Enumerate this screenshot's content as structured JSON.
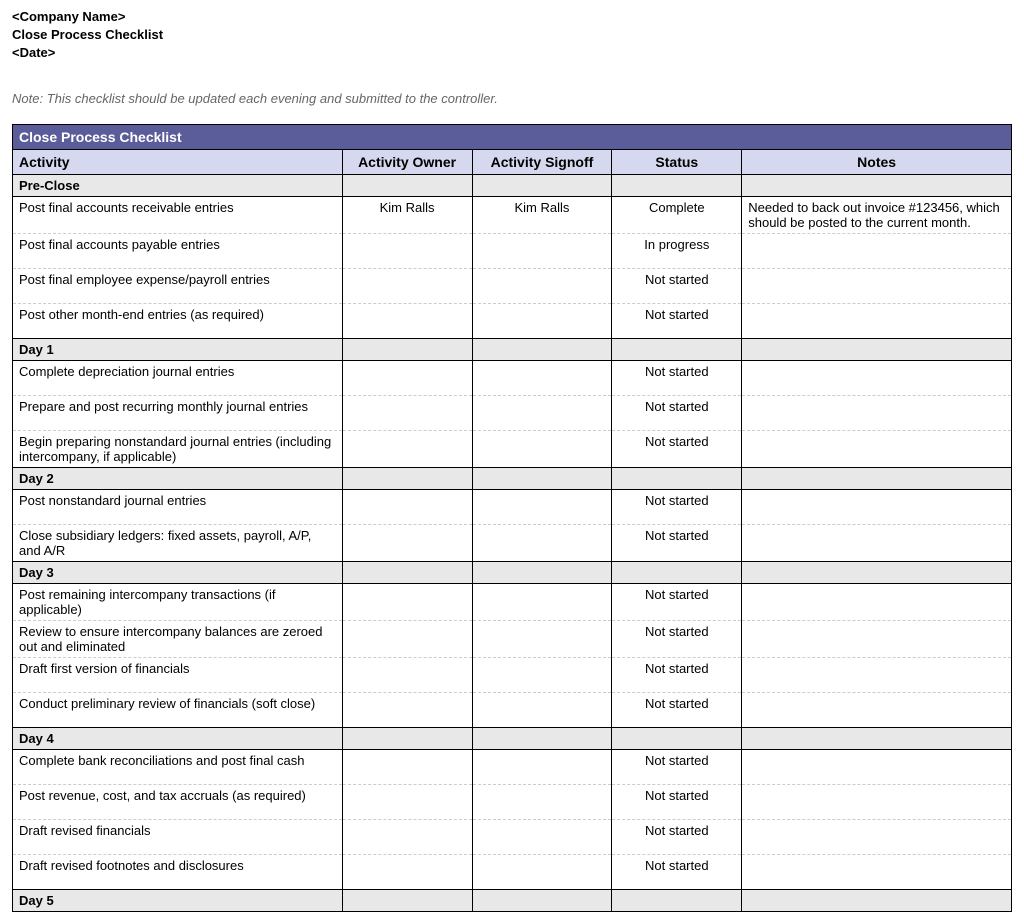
{
  "header": {
    "company": "<Company Name>",
    "title": "Close Process Checklist",
    "date": "<Date>"
  },
  "note": "Note: This checklist should be updated each evening and submitted to the controller.",
  "table_title": "Close Process Checklist",
  "columns": {
    "activity": "Activity",
    "owner": "Activity Owner",
    "signoff": "Activity Signoff",
    "status": "Status",
    "notes": "Notes"
  },
  "sections": [
    {
      "name": "Pre-Close",
      "rows": [
        {
          "activity": "Post final accounts receivable entries",
          "owner": "Kim Ralls",
          "signoff": "Kim Ralls",
          "status": "Complete",
          "notes": "Needed to back out invoice #123456, which should be posted to the current month."
        },
        {
          "activity": "Post final accounts payable entries",
          "owner": "",
          "signoff": "",
          "status": "In progress",
          "notes": ""
        },
        {
          "activity": "Post final employee expense/payroll entries",
          "owner": "",
          "signoff": "",
          "status": "Not started",
          "notes": ""
        },
        {
          "activity": "Post other month-end entries (as required)",
          "owner": "",
          "signoff": "",
          "status": "Not started",
          "notes": ""
        }
      ]
    },
    {
      "name": "Day 1",
      "rows": [
        {
          "activity": "Complete depreciation journal entries",
          "owner": "",
          "signoff": "",
          "status": "Not started",
          "notes": ""
        },
        {
          "activity": "Prepare and post recurring monthly journal entries",
          "owner": "",
          "signoff": "",
          "status": "Not started",
          "notes": ""
        },
        {
          "activity": "Begin preparing nonstandard journal entries (including intercompany, if applicable)",
          "owner": "",
          "signoff": "",
          "status": "Not started",
          "notes": ""
        }
      ]
    },
    {
      "name": "Day 2",
      "rows": [
        {
          "activity": "Post nonstandard journal entries",
          "owner": "",
          "signoff": "",
          "status": "Not started",
          "notes": ""
        },
        {
          "activity": "Close subsidiary ledgers: fixed assets, payroll, A/P, and A/R",
          "owner": "",
          "signoff": "",
          "status": "Not started",
          "notes": ""
        }
      ]
    },
    {
      "name": "Day 3",
      "rows": [
        {
          "activity": "Post remaining intercompany transactions (if applicable)",
          "owner": "",
          "signoff": "",
          "status": "Not started",
          "notes": ""
        },
        {
          "activity": "Review to ensure intercompany balances are zeroed out and eliminated",
          "owner": "",
          "signoff": "",
          "status": "Not started",
          "notes": ""
        },
        {
          "activity": "Draft first version of financials",
          "owner": "",
          "signoff": "",
          "status": "Not started",
          "notes": ""
        },
        {
          "activity": "Conduct preliminary review of financials (soft close)",
          "owner": "",
          "signoff": "",
          "status": "Not started",
          "notes": ""
        }
      ]
    },
    {
      "name": "Day 4",
      "rows": [
        {
          "activity": "Complete bank reconciliations and post final cash",
          "owner": "",
          "signoff": "",
          "status": "Not started",
          "notes": ""
        },
        {
          "activity": "Post revenue, cost, and tax accruals (as required)",
          "owner": "",
          "signoff": "",
          "status": "Not started",
          "notes": ""
        },
        {
          "activity": "Draft revised financials",
          "owner": "",
          "signoff": "",
          "status": "Not started",
          "notes": ""
        },
        {
          "activity": "Draft revised footnotes and disclosures",
          "owner": "",
          "signoff": "",
          "status": "Not started",
          "notes": ""
        }
      ]
    },
    {
      "name": "Day 5",
      "rows": []
    }
  ]
}
